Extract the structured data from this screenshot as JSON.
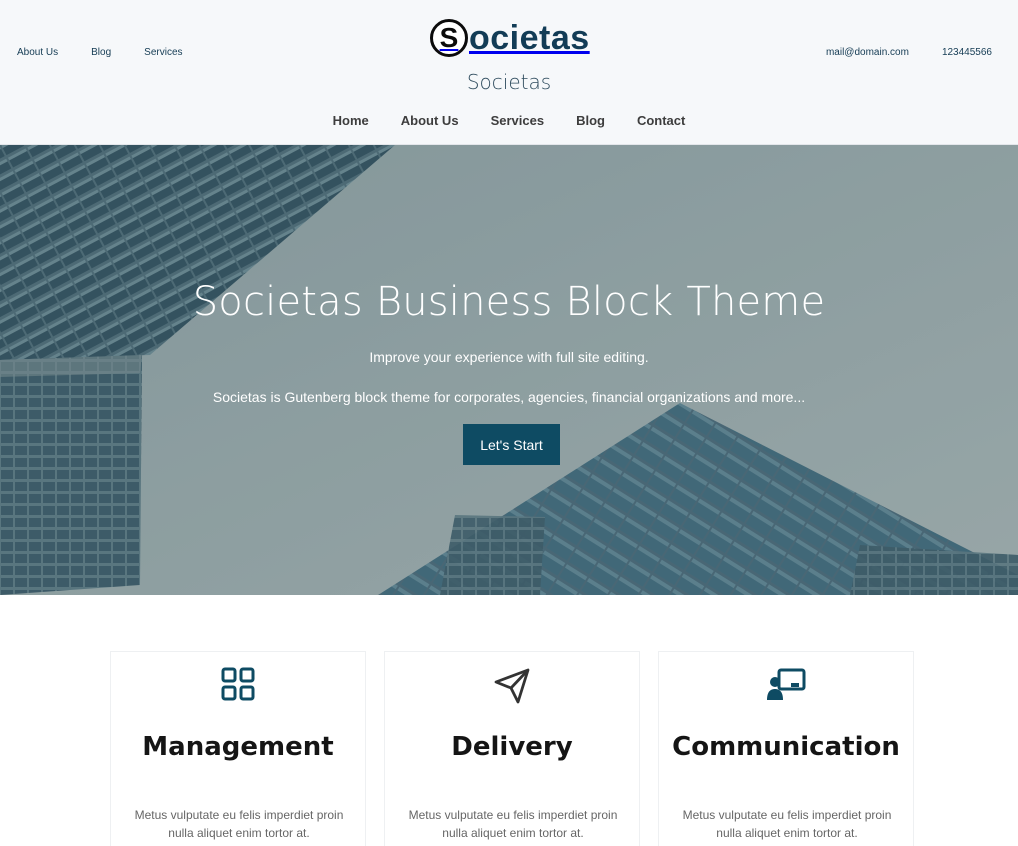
{
  "header": {
    "top_left_links": [
      "About Us",
      "Blog",
      "Services"
    ],
    "email": "mail@domain.com",
    "phone": "123445566",
    "logo_letter": "S",
    "logo_text": "ocietas",
    "site_title": "Societas",
    "nav": [
      "Home",
      "About Us",
      "Services",
      "Blog",
      "Contact"
    ]
  },
  "hero": {
    "title": "Societas Business Block Theme",
    "subtitle": "Improve your experience with full site editing.",
    "description": "Societas is Gutenberg block theme for corporates, agencies, financial organizations and more...",
    "cta_label": "Let's Start"
  },
  "features": [
    {
      "icon": "grid-icon",
      "title": "Management",
      "text": "Metus vulputate eu felis imperdiet proin nulla aliquet enim tortor at."
    },
    {
      "icon": "paper-plane-icon",
      "title": "Delivery",
      "text": "Metus vulputate eu felis imperdiet proin nulla aliquet enim tortor at."
    },
    {
      "icon": "presentation-icon",
      "title": "Communication",
      "text": "Metus vulputate eu felis imperdiet proin nulla aliquet enim tortor at."
    }
  ],
  "colors": {
    "brand": "#123c56",
    "button": "#0e4b63",
    "header_bg": "#f6f8fa"
  }
}
